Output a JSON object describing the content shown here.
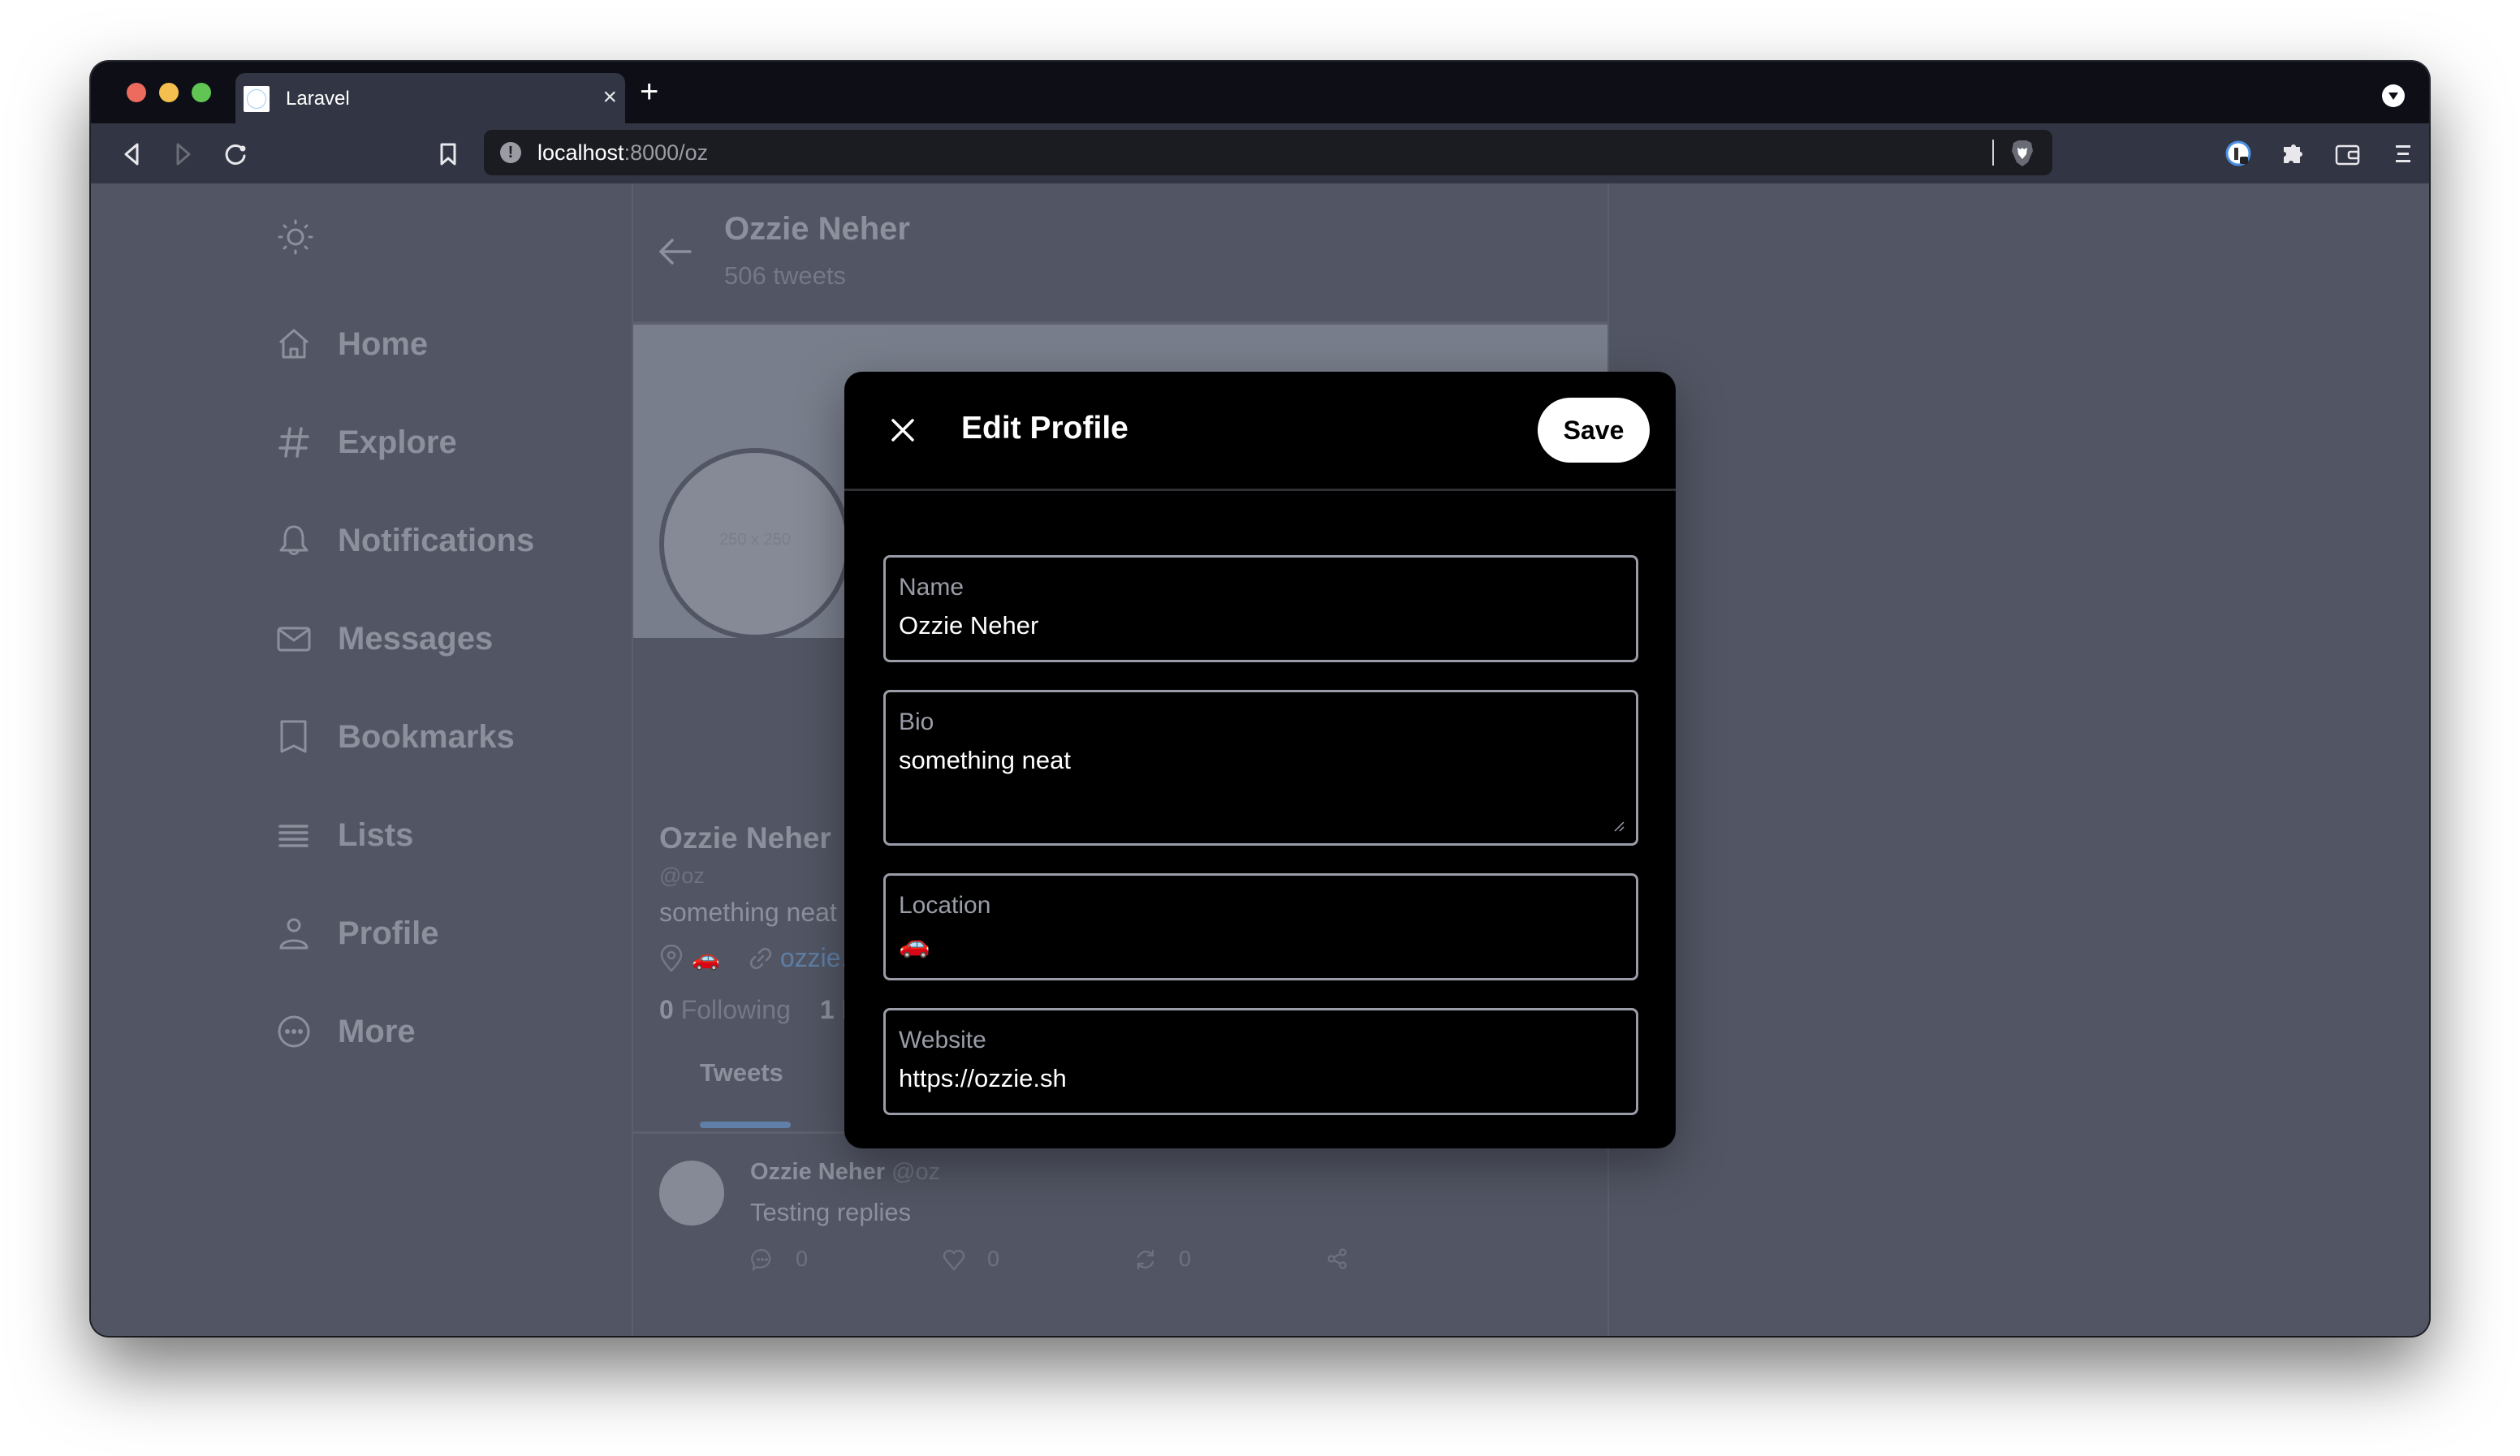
{
  "browser": {
    "tab_title": "Laravel",
    "tab_close_glyph": "×",
    "new_tab_glyph": "+",
    "url_host": "localhost",
    "url_rest": ":8000/oz",
    "info_glyph": "!",
    "icons": [
      "back-icon",
      "forward-icon",
      "reload-icon",
      "bookmark-icon",
      "site-info-icon",
      "brave-shields-icon",
      "password-manager-icon",
      "extensions-icon",
      "wallet-icon",
      "menu-icon",
      "tab-menu-icon"
    ]
  },
  "sidebar": {
    "theme_icon": "sun-icon",
    "items": [
      {
        "label": "Home",
        "icon": "home-icon"
      },
      {
        "label": "Explore",
        "icon": "hashtag-icon"
      },
      {
        "label": "Notifications",
        "icon": "bell-icon"
      },
      {
        "label": "Messages",
        "icon": "mail-icon"
      },
      {
        "label": "Bookmarks",
        "icon": "bookmark-icon"
      },
      {
        "label": "Lists",
        "icon": "list-icon"
      },
      {
        "label": "Profile",
        "icon": "user-icon"
      },
      {
        "label": "More",
        "icon": "more-icon"
      }
    ]
  },
  "profile": {
    "header_name": "Ozzie Neher",
    "tweet_count": "506 tweets",
    "avatar_placeholder": "250 x 250",
    "name": "Ozzie Neher",
    "handle": "@oz",
    "bio": "something neat",
    "location": "🚗",
    "website_display": "ozzie.",
    "following_count": "0",
    "following_label": "Following",
    "followers_count": "1",
    "followers_label": "F",
    "tabs": [
      {
        "label": "Tweets",
        "active": true
      }
    ]
  },
  "tweet": {
    "name": "Ozzie Neher",
    "handle": "@oz",
    "text": "Testing replies",
    "replies": "0",
    "likes": "0",
    "retweets": "0"
  },
  "modal": {
    "title": "Edit Profile",
    "save_label": "Save",
    "fields": [
      {
        "label": "Name",
        "value": "Ozzie Neher"
      },
      {
        "label": "Bio",
        "value": "something neat"
      },
      {
        "label": "Location",
        "value": "🚗"
      },
      {
        "label": "Website",
        "value": "https://ozzie.sh"
      }
    ]
  },
  "colors": {
    "link": "#5f7fa6",
    "modal_bg": "#000000",
    "overlay_bg": "#525664"
  }
}
